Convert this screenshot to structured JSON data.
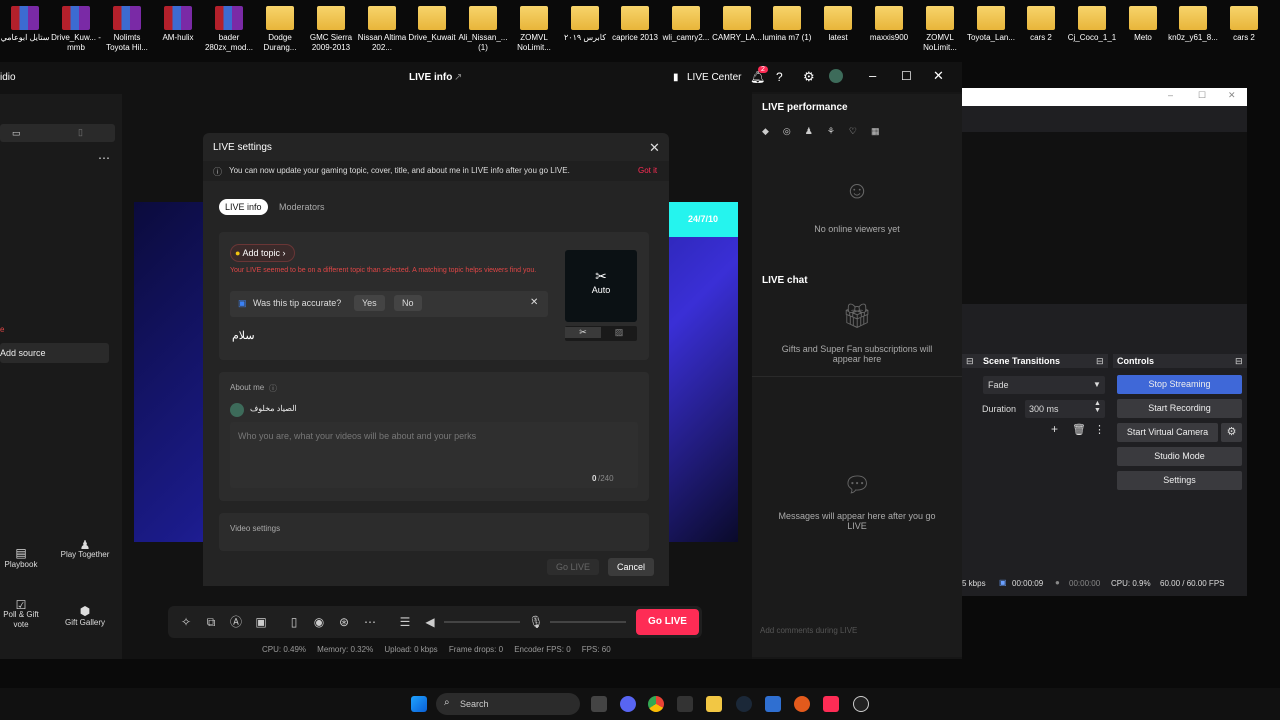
{
  "desktop": {
    "icons": [
      {
        "label": "ستايل ابوعامي",
        "type": "rar"
      },
      {
        "label": "Drive_Kuw... -mmb",
        "type": "rar"
      },
      {
        "label": "Nolimts Toyota Hil...",
        "type": "rar"
      },
      {
        "label": "AM-hulix",
        "type": "rar"
      },
      {
        "label": "bader 280zx_mod...",
        "type": "rar"
      },
      {
        "label": "Dodge Durang...",
        "type": "folder"
      },
      {
        "label": "GMC Sierra 2009-2013",
        "type": "folder"
      },
      {
        "label": "Nissan Altima 202...",
        "type": "folder"
      },
      {
        "label": "Drive_Kuwait",
        "type": "folder"
      },
      {
        "label": "Ali_Nissan_... (1)",
        "type": "folder"
      },
      {
        "label": "ZOMVL NoLimit...",
        "type": "folder"
      },
      {
        "label": "كابرس ٢٠١٩",
        "type": "folder"
      },
      {
        "label": "caprice 2013",
        "type": "folder"
      },
      {
        "label": "wli_camry2...",
        "type": "folder"
      },
      {
        "label": "CAMRY_LA...",
        "type": "folder"
      },
      {
        "label": "lumina m7 (1)",
        "type": "folder"
      },
      {
        "label": "latest",
        "type": "folder"
      },
      {
        "label": "maxxis900",
        "type": "folder"
      },
      {
        "label": "ZOMVL NoLimit...",
        "type": "folder"
      },
      {
        "label": "Toyota_Lan...",
        "type": "folder"
      },
      {
        "label": "cars 2",
        "type": "folder"
      },
      {
        "label": "Cj_Coco_1_1",
        "type": "folder"
      },
      {
        "label": "Meto",
        "type": "folder"
      },
      {
        "label": "kn0z_y61_8...",
        "type": "folder"
      },
      {
        "label": "cars 2",
        "type": "folder"
      }
    ]
  },
  "app": {
    "partial_title": "idio",
    "window_title": "LIVE info",
    "live_center": "LIVE Center",
    "notif_count": "2",
    "left": {
      "add_source": "Add source",
      "playbook": "Playbook",
      "play_together": "Play Together",
      "poll": "Poll & Gift vote",
      "gift_gallery": "Gift Gallery"
    },
    "preview_badge": "24/7/10",
    "go_live": "Go LIVE",
    "stats": {
      "cpu": "CPU: 0.49%",
      "memory": "Memory: 0.32%",
      "upload": "Upload: 0 kbps",
      "frame_drops": "Frame drops: 0",
      "encoder_fps": "Encoder FPS: 0",
      "fps": "FPS: 60"
    },
    "right": {
      "performance_title": "LIVE performance",
      "no_viewers": "No online viewers yet",
      "chat_title": "LIVE chat",
      "gifts_text": "Gifts and Super Fan subscriptions will appear here",
      "messages_text": "Messages will appear here after you go LIVE",
      "comment_placeholder": "Add comments during LIVE"
    }
  },
  "modal": {
    "title": "LIVE settings",
    "notice": "You can now update your gaming topic, cover, title, and about me in LIVE info after you go LIVE.",
    "got_it": "Got it",
    "tabs": [
      "LIVE info",
      "Moderators"
    ],
    "add_topic": "Add topic",
    "warning": "Your LIVE seemed to be on a different topic than selected. A matching topic helps viewers find you.",
    "tip_question": "Was this tip accurate?",
    "yes": "Yes",
    "no": "No",
    "title_value": "سلام",
    "cover_label": "Auto",
    "about_label": "About me",
    "about_name": "الصياد مخلوف",
    "about_placeholder": "Who you are, what your videos will be about and your perks",
    "about_count": "0",
    "about_max": "/240",
    "video_settings": "Video settings",
    "go_live": "Go LIVE",
    "cancel": "Cancel"
  },
  "obs": {
    "scene_transitions": "Scene Transitions",
    "controls": "Controls",
    "transition": "Fade",
    "duration_label": "Duration",
    "duration_value": "300 ms",
    "buttons": [
      "Stop Streaming",
      "Start Recording",
      "Start Virtual Camera",
      "Studio Mode",
      "Settings"
    ],
    "status": {
      "kbps": "5 kbps",
      "stream_time": "00:00:09",
      "rec_time": "00:00:00",
      "cpu": "CPU: 0.9%",
      "fps": "60.00 / 60.00 FPS"
    }
  },
  "taskbar": {
    "search_placeholder": "Search"
  }
}
